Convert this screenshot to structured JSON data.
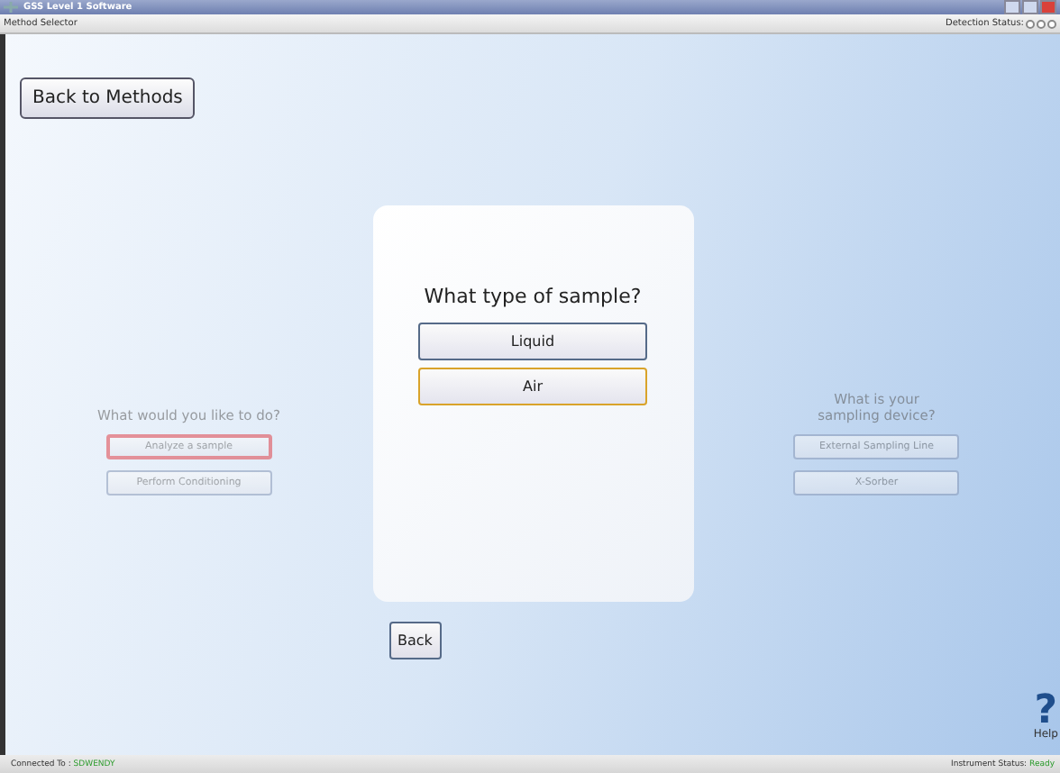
{
  "window": {
    "title": "GSS Level 1 Software"
  },
  "header": {
    "title": "Method Selector",
    "detection_label": "Detection Status:",
    "detection_lights": [
      {
        "on": false
      },
      {
        "on": false
      },
      {
        "on": false
      }
    ]
  },
  "back_to_methods": "Back to Methods",
  "left_panel": {
    "question": "What would you like to do?",
    "disabled": true,
    "options": [
      {
        "label": "Analyze a sample",
        "selected": true
      },
      {
        "label": "Perform Conditioning",
        "selected": false
      }
    ]
  },
  "center_panel": {
    "question": "What type of sample?",
    "options": [
      {
        "label": "Liquid",
        "selected": false
      },
      {
        "label": "Air",
        "selected": true
      }
    ]
  },
  "right_panel": {
    "question": "What is your sampling device?",
    "disabled": true,
    "options": [
      {
        "label": "External Sampling Line",
        "selected": false
      },
      {
        "label": "X-Sorber",
        "selected": false
      }
    ]
  },
  "back": "Back",
  "help": {
    "icon": "?",
    "label": "Help"
  },
  "status_bar": {
    "connected_label": "Connected To :",
    "connected_value": "SDWENDY",
    "instrument_label": "Instrument Status:",
    "instrument_value": "Ready"
  }
}
